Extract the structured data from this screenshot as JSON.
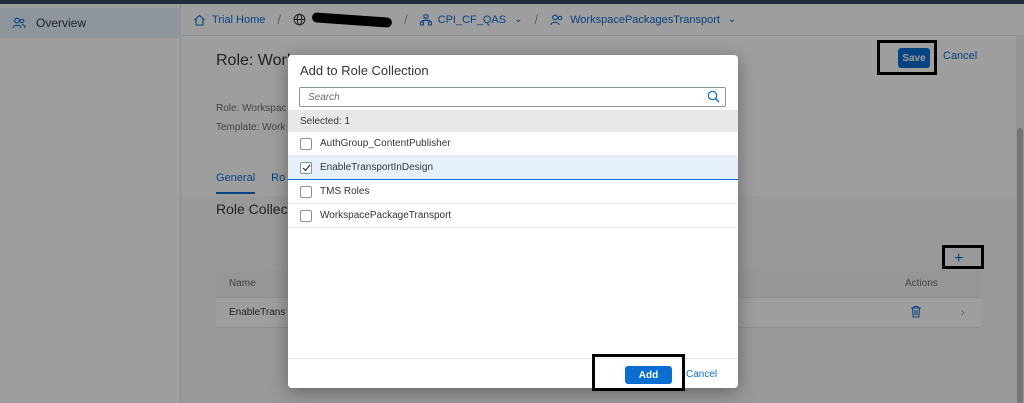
{
  "sidebar": {
    "items": [
      {
        "label": "Overview",
        "icon": "people-icon"
      }
    ]
  },
  "breadcrumb": {
    "items": [
      {
        "label": "Trial Home",
        "icon": "home-icon"
      },
      {
        "label": "",
        "icon": "globe-icon",
        "redacted": true
      },
      {
        "label": "CPI_CF_QAS",
        "icon": "space-icon"
      },
      {
        "label": "WorkspacePackagesTransport",
        "icon": "people-icon"
      }
    ]
  },
  "page": {
    "title": "Role: Work",
    "role_label": "Role: Workspac",
    "template_label": "Template: Work",
    "save_label": "Save",
    "cancel_label": "Cancel",
    "tabs": [
      {
        "label": "General"
      },
      {
        "label": "Ro"
      }
    ],
    "section_title": "Role Collect",
    "add_symbol": "+",
    "table": {
      "headers": {
        "name": "Name",
        "actions": "Actions"
      },
      "rows": [
        {
          "name": "EnableTrans"
        }
      ]
    }
  },
  "dialog": {
    "title": "Add to Role Collection",
    "search_placeholder": "Search",
    "selected_text": "Selected: 1",
    "items": [
      {
        "label": "AuthGroup_ContentPublisher",
        "checked": false
      },
      {
        "label": "EnableTransportInDesign",
        "checked": true
      },
      {
        "label": "TMS Roles",
        "checked": false
      },
      {
        "label": "WorkspacePackageTransport",
        "checked": false
      }
    ],
    "add_label": "Add",
    "cancel_label": "Cancel"
  },
  "colors": {
    "accent": "#0a6ed1",
    "shell": "#354a5f",
    "selected_row": "#e5f0fa",
    "highlight_border": "#000000"
  }
}
